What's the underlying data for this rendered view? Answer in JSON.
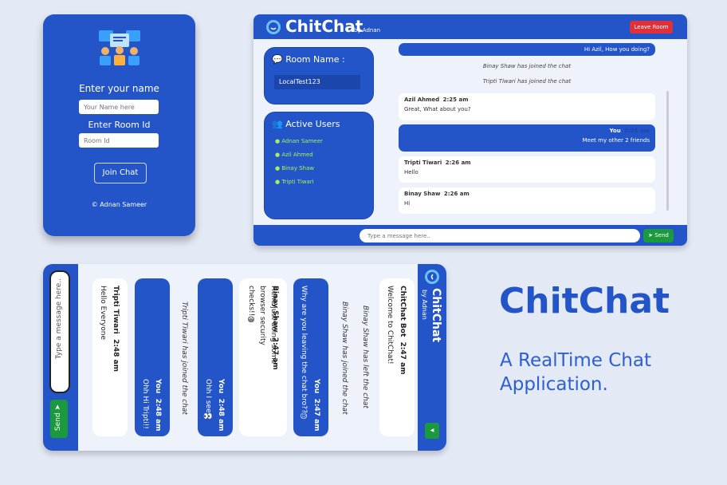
{
  "join": {
    "name_label": "Enter your name",
    "name_placeholder": "Your Name here",
    "room_label": "Enter Room Id",
    "room_placeholder": "Room Id",
    "join_button": "Join Chat",
    "footer": "© Adnan Sameer"
  },
  "app": {
    "title": "ChitChat",
    "by": "by Adnan",
    "leave_button": "Leave Room",
    "room_name_heading": "Room Name :",
    "room_name": "LocalTest123",
    "active_users_heading": "Active Users",
    "users": [
      "Adnan Sameer",
      "Azil Ahmed",
      "Binay Shaw",
      "Tripti Tiwari"
    ],
    "send_label": "Send",
    "message_placeholder": "Type a message here.."
  },
  "messages": [
    {
      "text": "Hi Azil, How you doing?"
    },
    {
      "system": "Binay Shaw has joined the chat"
    },
    {
      "system": "Tripti Tiwari has joined the chat"
    },
    {
      "author": "Azil Ahmed",
      "time": "2:25 am",
      "text": "Great, What about you?"
    },
    {
      "author": "You",
      "time": "2:25 am",
      "text": "Meet my other 2 friends"
    },
    {
      "author": "Tripti Tiwari",
      "time": "2:26 am",
      "text": "Hello"
    },
    {
      "author": "Binay Shaw",
      "time": "2:26 am",
      "text": "Hi"
    }
  ],
  "mobile": {
    "title": "ChitChat",
    "by": "by Adnan",
    "placeholder": "Type a message here..",
    "send_label": "Send",
    "messages": [
      {
        "author": "ChitChat Bot",
        "time": "2:47 am",
        "text": "Welcome to ChitChat!"
      },
      {
        "system": "Binay Shaw has left the chat"
      },
      {
        "system": "Binay Shaw has joined the chat"
      },
      {
        "author": "You",
        "time": "2:47 am",
        "text": "Why are you leaving the chat bro??😥"
      },
      {
        "author": "Binay Shaw",
        "time": "2:47 am",
        "text": "Hehe just doing some browser security checks!!😁"
      },
      {
        "author": "You",
        "time": "2:48 am",
        "text": "Ohh I see👀"
      },
      {
        "system": "Tripti Tiwari has joined the chat"
      },
      {
        "author": "You",
        "time": "2:48 am",
        "text": "Ohh Hi Tripti!!"
      },
      {
        "author": "Tripti Tiwari",
        "time": "2:48 am",
        "text": "Hello Everyone"
      }
    ]
  },
  "promo": {
    "title": "ChitChat",
    "subtitle_line1": "A RealTime Chat",
    "subtitle_line2": "Application."
  },
  "colors": {
    "primary": "#2355c8",
    "leave": "#e0303a",
    "send": "#1a9a3c",
    "user_green": "#a6f05a"
  }
}
